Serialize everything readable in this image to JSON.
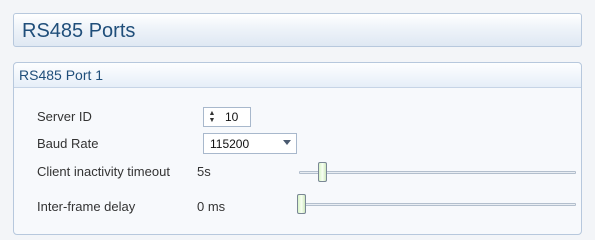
{
  "page": {
    "title": "RS485 Ports"
  },
  "port": {
    "title": "RS485 Port 1",
    "server_id": {
      "label": "Server ID",
      "value": "10"
    },
    "baud_rate": {
      "label": "Baud Rate",
      "value": "115200"
    },
    "client_inactivity_timeout": {
      "label": "Client inactivity timeout",
      "value": "5s",
      "slider_fraction": 0.08
    },
    "inter_frame_delay": {
      "label": "Inter-frame delay",
      "value": "0 ms",
      "slider_fraction": 0.0
    }
  },
  "icons": {
    "spinner": "up-down-spinner-icon",
    "dropdown": "chevron-down-icon"
  }
}
